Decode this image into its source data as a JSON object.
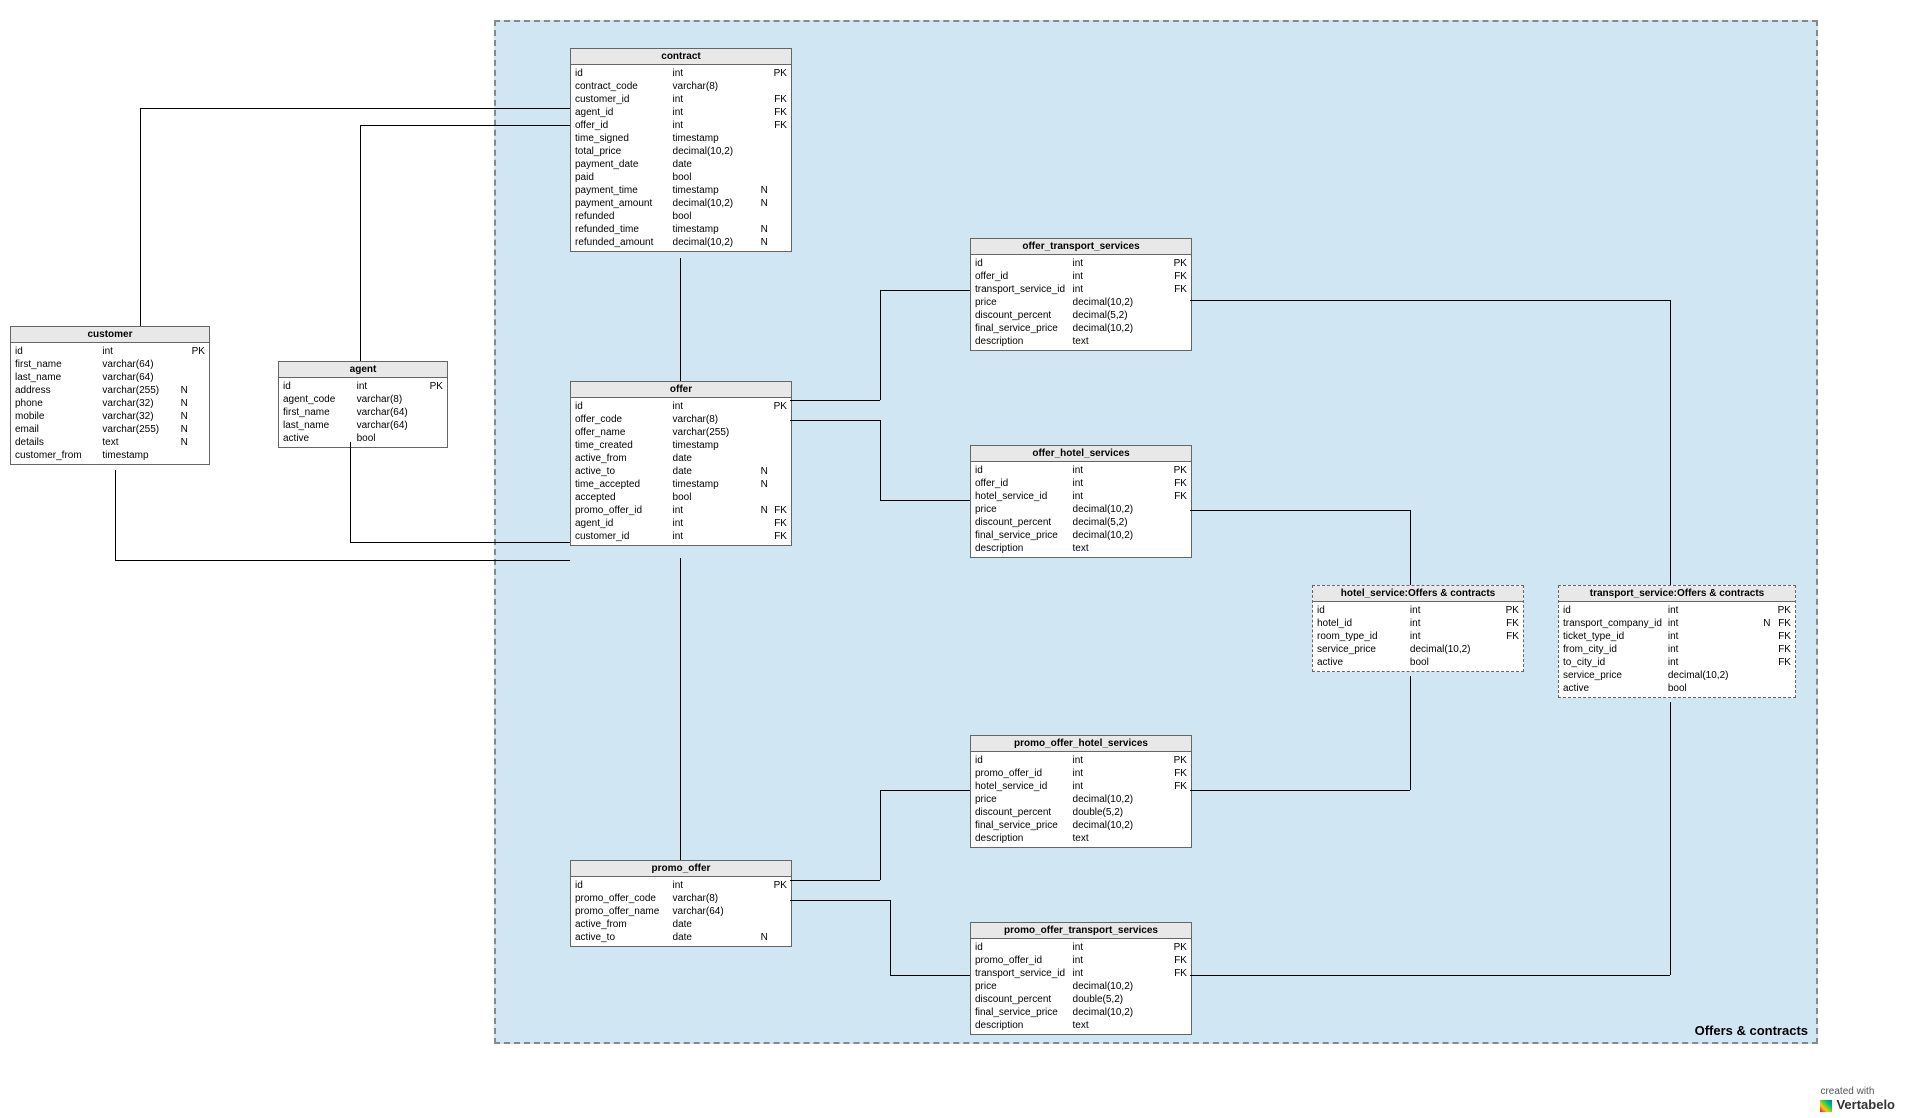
{
  "region": {
    "label": "Offers & contracts"
  },
  "footer": {
    "line1": "created with",
    "line2": "Vertabelo"
  },
  "entities": {
    "customer": {
      "title": "customer",
      "rows": [
        {
          "n": "id",
          "t": "int",
          "f": "",
          "k": "PK"
        },
        {
          "n": "first_name",
          "t": "varchar(64)",
          "f": "",
          "k": ""
        },
        {
          "n": "last_name",
          "t": "varchar(64)",
          "f": "",
          "k": ""
        },
        {
          "n": "address",
          "t": "varchar(255)",
          "f": "N",
          "k": ""
        },
        {
          "n": "phone",
          "t": "varchar(32)",
          "f": "N",
          "k": ""
        },
        {
          "n": "mobile",
          "t": "varchar(32)",
          "f": "N",
          "k": ""
        },
        {
          "n": "email",
          "t": "varchar(255)",
          "f": "N",
          "k": ""
        },
        {
          "n": "details",
          "t": "text",
          "f": "N",
          "k": ""
        },
        {
          "n": "customer_from",
          "t": "timestamp",
          "f": "",
          "k": ""
        }
      ]
    },
    "agent": {
      "title": "agent",
      "rows": [
        {
          "n": "id",
          "t": "int",
          "f": "",
          "k": "PK"
        },
        {
          "n": "agent_code",
          "t": "varchar(8)",
          "f": "",
          "k": ""
        },
        {
          "n": "first_name",
          "t": "varchar(64)",
          "f": "",
          "k": ""
        },
        {
          "n": "last_name",
          "t": "varchar(64)",
          "f": "",
          "k": ""
        },
        {
          "n": "active",
          "t": "bool",
          "f": "",
          "k": ""
        }
      ]
    },
    "contract": {
      "title": "contract",
      "rows": [
        {
          "n": "id",
          "t": "int",
          "f": "",
          "k": "PK"
        },
        {
          "n": "contract_code",
          "t": "varchar(8)",
          "f": "",
          "k": ""
        },
        {
          "n": "customer_id",
          "t": "int",
          "f": "",
          "k": "FK"
        },
        {
          "n": "agent_id",
          "t": "int",
          "f": "",
          "k": "FK"
        },
        {
          "n": "offer_id",
          "t": "int",
          "f": "",
          "k": "FK"
        },
        {
          "n": "time_signed",
          "t": "timestamp",
          "f": "",
          "k": ""
        },
        {
          "n": "total_price",
          "t": "decimal(10,2)",
          "f": "",
          "k": ""
        },
        {
          "n": "payment_date",
          "t": "date",
          "f": "",
          "k": ""
        },
        {
          "n": "paid",
          "t": "bool",
          "f": "",
          "k": ""
        },
        {
          "n": "payment_time",
          "t": "timestamp",
          "f": "N",
          "k": ""
        },
        {
          "n": "payment_amount",
          "t": "decimal(10,2)",
          "f": "N",
          "k": ""
        },
        {
          "n": "refunded",
          "t": "bool",
          "f": "",
          "k": ""
        },
        {
          "n": "refunded_time",
          "t": "timestamp",
          "f": "N",
          "k": ""
        },
        {
          "n": "refunded_amount",
          "t": "decimal(10,2)",
          "f": "N",
          "k": ""
        }
      ]
    },
    "offer": {
      "title": "offer",
      "rows": [
        {
          "n": "id",
          "t": "int",
          "f": "",
          "k": "PK"
        },
        {
          "n": "offer_code",
          "t": "varchar(8)",
          "f": "",
          "k": ""
        },
        {
          "n": "offer_name",
          "t": "varchar(255)",
          "f": "",
          "k": ""
        },
        {
          "n": "time_created",
          "t": "timestamp",
          "f": "",
          "k": ""
        },
        {
          "n": "active_from",
          "t": "date",
          "f": "",
          "k": ""
        },
        {
          "n": "active_to",
          "t": "date",
          "f": "N",
          "k": ""
        },
        {
          "n": "time_accepted",
          "t": "timestamp",
          "f": "N",
          "k": ""
        },
        {
          "n": "accepted",
          "t": "bool",
          "f": "",
          "k": ""
        },
        {
          "n": "promo_offer_id",
          "t": "int",
          "f": "N",
          "k": "FK"
        },
        {
          "n": "agent_id",
          "t": "int",
          "f": "",
          "k": "FK"
        },
        {
          "n": "customer_id",
          "t": "int",
          "f": "",
          "k": "FK"
        }
      ]
    },
    "promo_offer": {
      "title": "promo_offer",
      "rows": [
        {
          "n": "id",
          "t": "int",
          "f": "",
          "k": "PK"
        },
        {
          "n": "promo_offer_code",
          "t": "varchar(8)",
          "f": "",
          "k": ""
        },
        {
          "n": "promo_offer_name",
          "t": "varchar(64)",
          "f": "",
          "k": ""
        },
        {
          "n": "active_from",
          "t": "date",
          "f": "",
          "k": ""
        },
        {
          "n": "active_to",
          "t": "date",
          "f": "N",
          "k": ""
        }
      ]
    },
    "offer_transport_services": {
      "title": "offer_transport_services",
      "rows": [
        {
          "n": "id",
          "t": "int",
          "f": "",
          "k": "PK"
        },
        {
          "n": "offer_id",
          "t": "int",
          "f": "",
          "k": "FK"
        },
        {
          "n": "transport_service_id",
          "t": "int",
          "f": "",
          "k": "FK"
        },
        {
          "n": "price",
          "t": "decimal(10,2)",
          "f": "",
          "k": ""
        },
        {
          "n": "discount_percent",
          "t": "decimal(5,2)",
          "f": "",
          "k": ""
        },
        {
          "n": "final_service_price",
          "t": "decimal(10,2)",
          "f": "",
          "k": ""
        },
        {
          "n": "description",
          "t": "text",
          "f": "",
          "k": ""
        }
      ]
    },
    "offer_hotel_services": {
      "title": "offer_hotel_services",
      "rows": [
        {
          "n": "id",
          "t": "int",
          "f": "",
          "k": "PK"
        },
        {
          "n": "offer_id",
          "t": "int",
          "f": "",
          "k": "FK"
        },
        {
          "n": "hotel_service_id",
          "t": "int",
          "f": "",
          "k": "FK"
        },
        {
          "n": "price",
          "t": "decimal(10,2)",
          "f": "",
          "k": ""
        },
        {
          "n": "discount_percent",
          "t": "decimal(5,2)",
          "f": "",
          "k": ""
        },
        {
          "n": "final_service_price",
          "t": "decimal(10,2)",
          "f": "",
          "k": ""
        },
        {
          "n": "description",
          "t": "text",
          "f": "",
          "k": ""
        }
      ]
    },
    "hotel_service": {
      "title": "hotel_service:Offers & contracts",
      "rows": [
        {
          "n": "id",
          "t": "int",
          "f": "",
          "k": "PK"
        },
        {
          "n": "hotel_id",
          "t": "int",
          "f": "",
          "k": "FK"
        },
        {
          "n": "room_type_id",
          "t": "int",
          "f": "",
          "k": "FK"
        },
        {
          "n": "service_price",
          "t": "decimal(10,2)",
          "f": "",
          "k": ""
        },
        {
          "n": "active",
          "t": "bool",
          "f": "",
          "k": ""
        }
      ]
    },
    "transport_service": {
      "title": "transport_service:Offers & contracts",
      "rows": [
        {
          "n": "id",
          "t": "int",
          "f": "",
          "k": "PK"
        },
        {
          "n": "transport_company_id",
          "t": "int",
          "f": "N",
          "k": "FK"
        },
        {
          "n": "ticket_type_id",
          "t": "int",
          "f": "",
          "k": "FK"
        },
        {
          "n": "from_city_id",
          "t": "int",
          "f": "",
          "k": "FK"
        },
        {
          "n": "to_city_id",
          "t": "int",
          "f": "",
          "k": "FK"
        },
        {
          "n": "service_price",
          "t": "decimal(10,2)",
          "f": "",
          "k": ""
        },
        {
          "n": "active",
          "t": "bool",
          "f": "",
          "k": ""
        }
      ]
    },
    "promo_offer_hotel_services": {
      "title": "promo_offer_hotel_services",
      "rows": [
        {
          "n": "id",
          "t": "int",
          "f": "",
          "k": "PK"
        },
        {
          "n": "promo_offer_id",
          "t": "int",
          "f": "",
          "k": "FK"
        },
        {
          "n": "hotel_service_id",
          "t": "int",
          "f": "",
          "k": "FK"
        },
        {
          "n": "price",
          "t": "decimal(10,2)",
          "f": "",
          "k": ""
        },
        {
          "n": "discount_percent",
          "t": "double(5,2)",
          "f": "",
          "k": ""
        },
        {
          "n": "final_service_price",
          "t": "decimal(10,2)",
          "f": "",
          "k": ""
        },
        {
          "n": "description",
          "t": "text",
          "f": "",
          "k": ""
        }
      ]
    },
    "promo_offer_transport_services": {
      "title": "promo_offer_transport_services",
      "rows": [
        {
          "n": "id",
          "t": "int",
          "f": "",
          "k": "PK"
        },
        {
          "n": "promo_offer_id",
          "t": "int",
          "f": "",
          "k": "FK"
        },
        {
          "n": "transport_service_id",
          "t": "int",
          "f": "",
          "k": "FK"
        },
        {
          "n": "price",
          "t": "decimal(10,2)",
          "f": "",
          "k": ""
        },
        {
          "n": "discount_percent",
          "t": "double(5,2)",
          "f": "",
          "k": ""
        },
        {
          "n": "final_service_price",
          "t": "decimal(10,2)",
          "f": "",
          "k": ""
        },
        {
          "n": "description",
          "t": "text",
          "f": "",
          "k": ""
        }
      ]
    }
  },
  "chart_data": {
    "type": "er-diagram",
    "title": "Offers & contracts",
    "entities": [
      "customer",
      "agent",
      "contract",
      "offer",
      "promo_offer",
      "offer_transport_services",
      "offer_hotel_services",
      "hotel_service",
      "transport_service",
      "promo_offer_hotel_services",
      "promo_offer_transport_services"
    ],
    "relationships": [
      {
        "from": "customer",
        "to": "contract",
        "via": "customer_id"
      },
      {
        "from": "agent",
        "to": "contract",
        "via": "agent_id"
      },
      {
        "from": "offer",
        "to": "contract",
        "via": "offer_id"
      },
      {
        "from": "customer",
        "to": "offer",
        "via": "customer_id"
      },
      {
        "from": "agent",
        "to": "offer",
        "via": "agent_id"
      },
      {
        "from": "promo_offer",
        "to": "offer",
        "via": "promo_offer_id"
      },
      {
        "from": "offer",
        "to": "offer_transport_services",
        "via": "offer_id"
      },
      {
        "from": "offer",
        "to": "offer_hotel_services",
        "via": "offer_id"
      },
      {
        "from": "transport_service",
        "to": "offer_transport_services",
        "via": "transport_service_id"
      },
      {
        "from": "hotel_service",
        "to": "offer_hotel_services",
        "via": "hotel_service_id"
      },
      {
        "from": "promo_offer",
        "to": "promo_offer_hotel_services",
        "via": "promo_offer_id"
      },
      {
        "from": "promo_offer",
        "to": "promo_offer_transport_services",
        "via": "promo_offer_id"
      },
      {
        "from": "hotel_service",
        "to": "promo_offer_hotel_services",
        "via": "hotel_service_id"
      },
      {
        "from": "transport_service",
        "to": "promo_offer_transport_services",
        "via": "transport_service_id"
      }
    ]
  }
}
